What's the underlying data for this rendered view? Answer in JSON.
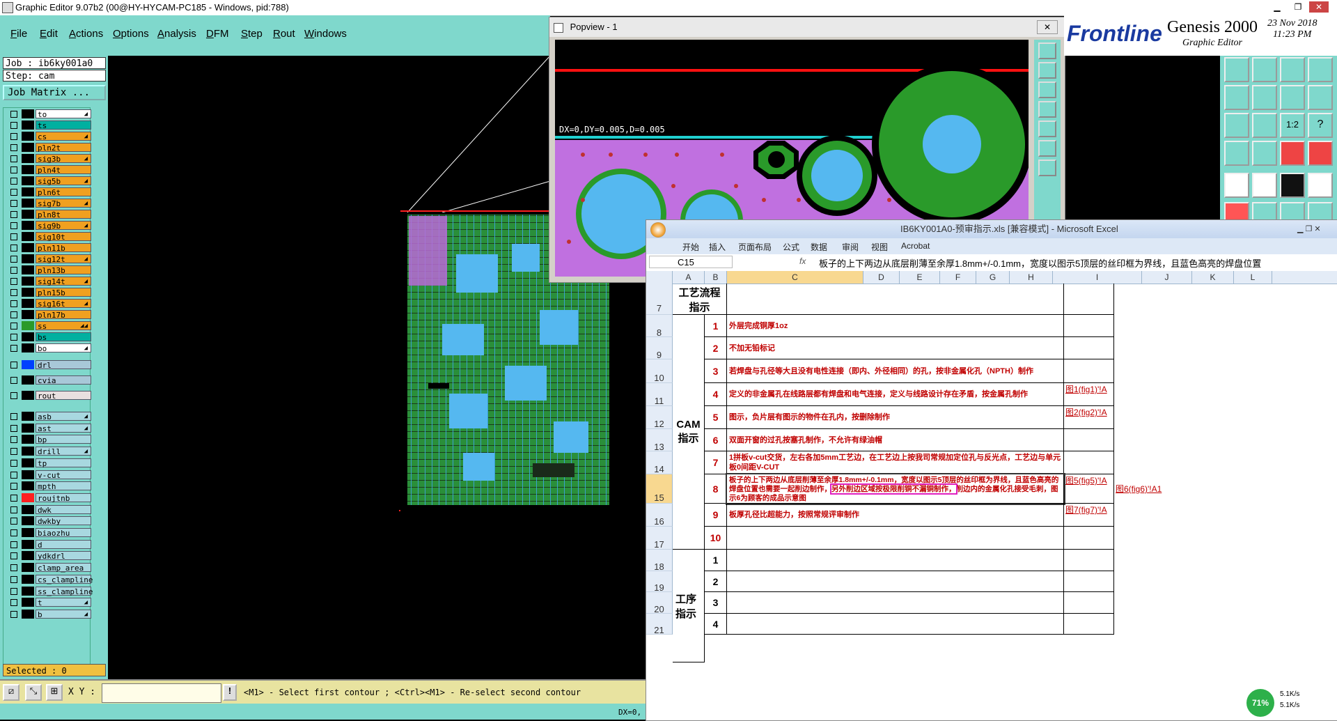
{
  "titlebar": {
    "title": "Graphic Editor 9.07b2 (00@HY-HYCAM-PC185 - Windows, pid:788)"
  },
  "menu": [
    "File",
    "Edit",
    "Actions",
    "Options",
    "Analysis",
    "DFM",
    "Step",
    "Rout",
    "Windows"
  ],
  "left_panel": {
    "job": "Job : ib6ky001a0",
    "step": "Step: cam",
    "job_matrix": "Job Matrix ...",
    "selected": "Selected : 0",
    "layers": [
      {
        "name": "to",
        "color": "#ffffff",
        "swatch": "#000000",
        "arrow": "◢"
      },
      {
        "name": "ts",
        "color": "#00b0a0",
        "swatch": "#000000",
        "arrow": ""
      },
      {
        "name": "cs",
        "color": "#f0a020",
        "swatch": "#000000",
        "arrow": "◢"
      },
      {
        "name": "pln2t",
        "color": "#f0a020",
        "swatch": "#000000",
        "arrow": ""
      },
      {
        "name": "sig3b",
        "color": "#f0a020",
        "swatch": "#000000",
        "arrow": "◢"
      },
      {
        "name": "pln4t",
        "color": "#f0a020",
        "swatch": "#000000",
        "arrow": ""
      },
      {
        "name": "sig5b",
        "color": "#f0a020",
        "swatch": "#000000",
        "arrow": "◢"
      },
      {
        "name": "pln6t",
        "color": "#f0a020",
        "swatch": "#000000",
        "arrow": ""
      },
      {
        "name": "sig7b",
        "color": "#f0a020",
        "swatch": "#000000",
        "arrow": "◢"
      },
      {
        "name": "pln8t",
        "color": "#f0a020",
        "swatch": "#000000",
        "arrow": ""
      },
      {
        "name": "sig9b",
        "color": "#f0a020",
        "swatch": "#000000",
        "arrow": "◢"
      },
      {
        "name": "sig10t",
        "color": "#f0a020",
        "swatch": "#000000",
        "arrow": ""
      },
      {
        "name": "pln11b",
        "color": "#f0a020",
        "swatch": "#000000",
        "arrow": ""
      },
      {
        "name": "sig12t",
        "color": "#f0a020",
        "swatch": "#000000",
        "arrow": "◢"
      },
      {
        "name": "pln13b",
        "color": "#f0a020",
        "swatch": "#000000",
        "arrow": ""
      },
      {
        "name": "sig14t",
        "color": "#f0a020",
        "swatch": "#000000",
        "arrow": "◢"
      },
      {
        "name": "pln15b",
        "color": "#f0a020",
        "swatch": "#000000",
        "arrow": ""
      },
      {
        "name": "sig16t",
        "color": "#f0a020",
        "swatch": "#000000",
        "arrow": "◢"
      },
      {
        "name": "pln17b",
        "color": "#f0a020",
        "swatch": "#000000",
        "arrow": ""
      },
      {
        "name": "ss",
        "color": "#f0a020",
        "swatch": "#2a9a2a",
        "arrow": "◢◢"
      },
      {
        "name": "bs",
        "color": "#00b0a0",
        "swatch": "#000000",
        "arrow": ""
      },
      {
        "name": "bo",
        "color": "#ffffff",
        "swatch": "#000000",
        "arrow": "◢"
      }
    ],
    "layers2": [
      {
        "name": "drl",
        "color": "#a8c8d8",
        "swatch": "#0040ff"
      },
      {
        "name": "cvia",
        "color": "#a8c8d8",
        "swatch": "#000000"
      },
      {
        "name": "rout",
        "color": "#e8e0e0",
        "swatch": "#000000"
      }
    ],
    "layers3": [
      {
        "name": "asb",
        "color": "#a8d8e0",
        "swatch": "#000000",
        "arrow": "◢"
      },
      {
        "name": "ast",
        "color": "#a8d8e0",
        "swatch": "#000000",
        "arrow": "◢"
      },
      {
        "name": "bp",
        "color": "#a8d8e0",
        "swatch": "#000000",
        "arrow": ""
      },
      {
        "name": "drill",
        "color": "#a8d8e0",
        "swatch": "#000000",
        "arrow": "◢"
      },
      {
        "name": "tp",
        "color": "#a8d8e0",
        "swatch": "#000000",
        "arrow": ""
      },
      {
        "name": "v-cut",
        "color": "#a8d8e0",
        "swatch": "#000000",
        "arrow": ""
      },
      {
        "name": "mpth",
        "color": "#a8d8e0",
        "swatch": "#000000",
        "arrow": ""
      },
      {
        "name": "roujtnb",
        "color": "#a8d8e0",
        "swatch": "#ff2020",
        "arrow": ""
      },
      {
        "name": "dwk",
        "color": "#a8d8e0",
        "swatch": "#000000",
        "arrow": ""
      },
      {
        "name": "dwkby",
        "color": "#a8d8e0",
        "swatch": "#000000",
        "arrow": ""
      },
      {
        "name": "biaozhu",
        "color": "#a8d8e0",
        "swatch": "#000000",
        "arrow": ""
      },
      {
        "name": "d",
        "color": "#a8d8e0",
        "swatch": "#000000",
        "arrow": ""
      },
      {
        "name": "ydkdrl",
        "color": "#a8d8e0",
        "swatch": "#000000",
        "arrow": ""
      },
      {
        "name": "clamp_area",
        "color": "#a8d8e0",
        "swatch": "#000000",
        "arrow": ""
      },
      {
        "name": "cs_clampline",
        "color": "#a8d8e0",
        "swatch": "#000000",
        "arrow": ""
      },
      {
        "name": "ss_clampline",
        "color": "#a8d8e0",
        "swatch": "#000000",
        "arrow": ""
      },
      {
        "name": "t",
        "color": "#a8d8e0",
        "swatch": "#000000",
        "arrow": "◢"
      },
      {
        "name": "b",
        "color": "#a8d8e0",
        "swatch": "#000000",
        "arrow": "◢"
      }
    ]
  },
  "bottom": {
    "xy_label": "X Y :",
    "xy_value": "",
    "prompt": "<M1> - Select first contour ; <Ctrl><M1> - Re-select second contour",
    "dx": "DX=0,"
  },
  "popview": {
    "title": "Popview - 1",
    "measure": "DX=0,DY=0.005,D=0.005"
  },
  "genesis": {
    "logo": "Frontline",
    "product": "Genesis 2000",
    "sub": "Graphic Editor",
    "date": "23 Nov 2018",
    "time": "11:23 PM"
  },
  "excel": {
    "title": "IB6KY001A0-预审指示.xls [兼容模式] - Microsoft Excel",
    "ribbon": [
      "开始",
      "插入",
      "页面布局",
      "公式",
      "数据",
      "审阅",
      "视图",
      "Acrobat"
    ],
    "namebox": "C15",
    "fx": "fx",
    "formula": "板子的上下两边从底层削薄至余厚1.8mm+/-0.1mm，宽度以图示5顶层的丝印框为界线，且蓝色高亮的焊盘位置",
    "columns": [
      "A",
      "B",
      "C",
      "D",
      "E",
      "F",
      "G",
      "H",
      "I",
      "J",
      "K",
      "L"
    ],
    "row_numbers": [
      "7",
      "8",
      "9",
      "10",
      "11",
      "12",
      "13",
      "14",
      "15",
      "16",
      "17",
      "18",
      "19",
      "20",
      "21"
    ],
    "section1_label": "工艺流程指示",
    "section2_label": "CAM指示",
    "section3_label": "工序指示",
    "items": [
      {
        "n": "1",
        "text": "外层完成铜厚1oz",
        "link": ""
      },
      {
        "n": "2",
        "text": "不加无铅标记",
        "link": ""
      },
      {
        "n": "3",
        "text": "若焊盘与孔径等大且没有电性连接（即内、外径相同）的孔，按非金属化孔（NPTH）制作",
        "link": ""
      },
      {
        "n": "4",
        "text": "定义的非金属孔在线路层都有焊盘和电气连接，定义与线路设计存在矛盾，按金属孔制作",
        "link": "图1(fig1)'!A"
      },
      {
        "n": "5",
        "text": "图示，负片层有图示的物件在孔内，按删除制作",
        "link": "图2(fig2)'!A"
      },
      {
        "n": "6",
        "text": "双面开窗的过孔按塞孔制作，不允许有绿油帽",
        "link": ""
      },
      {
        "n": "7",
        "text": "1拼板v-cut交货，左右各加5mm工艺边，在工艺边上按我司常规加定位孔与反光点，工艺边与单元板0间距V-CUT",
        "link": ""
      },
      {
        "n": "8",
        "text_a": "板子的上下两边从底层削薄至余厚1.8mm+/-0.1mm，宽度以图示5顶层的丝印框为界线，且蓝色高亮的焊盘位置也需要一起削边制作，",
        "text_hl": "另外削边区域按极限削铜不漏铜制作，",
        "text_b": "削边内的金属化孔接受毛刺，图示6为顾客的成品示意图",
        "link": "图5(fig5)'!A",
        "link2": "图6(fig6)'!A1"
      },
      {
        "n": "9",
        "text": "板厚孔径比超能力，按照常规评审制作",
        "link": "图7(fig7)'!A"
      },
      {
        "n": "10",
        "text": "",
        "link": ""
      }
    ],
    "items2": [
      "1",
      "2",
      "3",
      "4"
    ]
  },
  "tray": {
    "percent": "71%",
    "up": "5.1K/s",
    "down": "5.1K/s"
  }
}
